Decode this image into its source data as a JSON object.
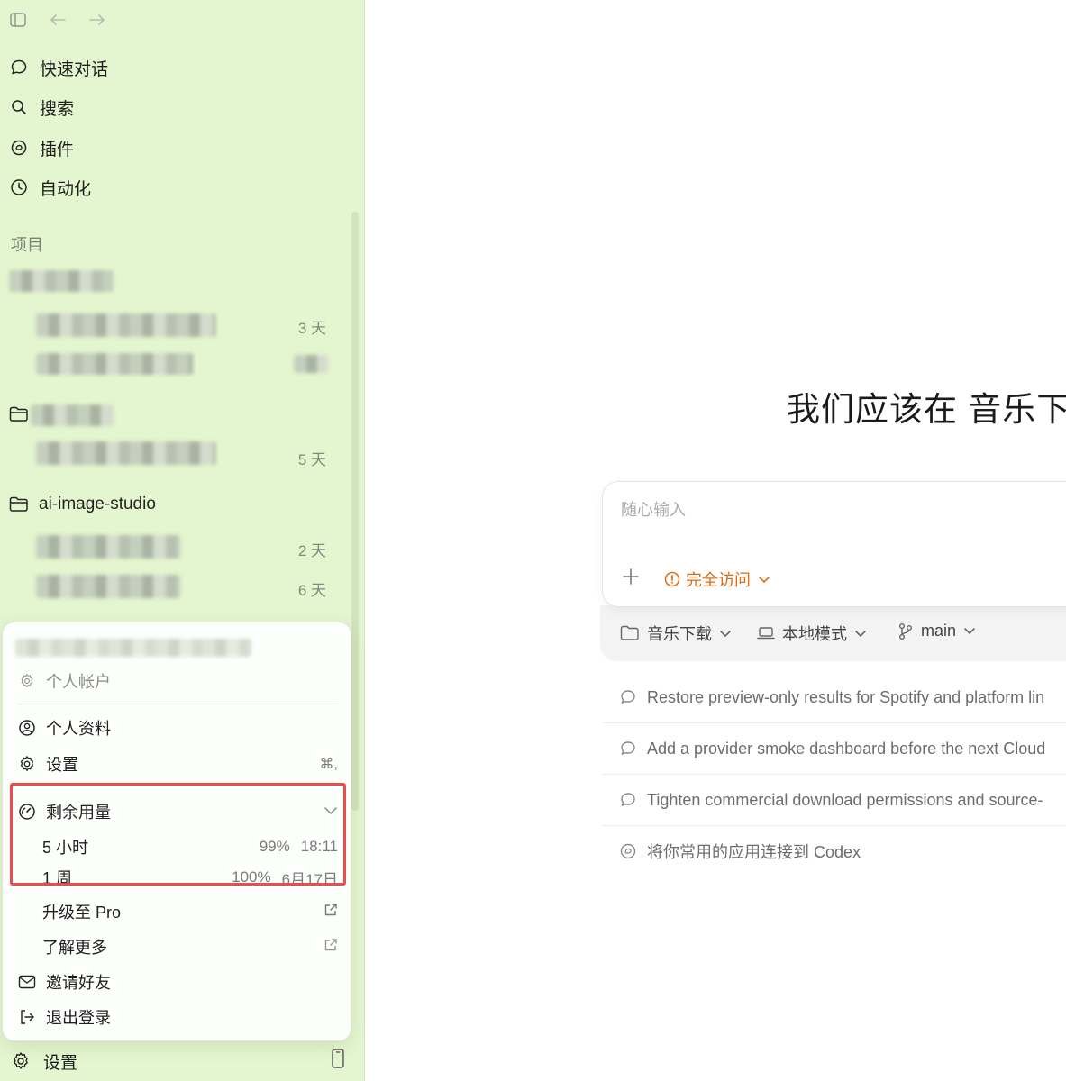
{
  "nav": {
    "quick_chat": "快速对话",
    "search": "搜索",
    "plugins": "插件",
    "automation": "自动化"
  },
  "projects": {
    "section_label": "项目",
    "threads_time": [
      "3 天",
      "5 天",
      "2 天",
      "6 天"
    ],
    "named_project": "ai-image-studio"
  },
  "menu": {
    "account_label": "个人帐户",
    "profile": "个人资料",
    "settings": "设置",
    "settings_shortcut": "⌘,",
    "usage_title": "剩余用量",
    "usage": [
      {
        "period": "5 小时",
        "percent": "99%",
        "reset": "18:11"
      },
      {
        "period": "1 周",
        "percent": "100%",
        "reset": "6月17日"
      }
    ],
    "upgrade": "升级至 Pro",
    "learn_more": "了解更多",
    "invite": "邀请好友",
    "logout": "退出登录"
  },
  "footer": {
    "settings": "设置"
  },
  "main": {
    "headline": "我们应该在 音乐下",
    "composer_placeholder": "随心输入",
    "access_label": "完全访问",
    "folder_label": "音乐下载",
    "mode_label": "本地模式",
    "branch_label": "main",
    "suggestions": [
      "Restore preview-only results for Spotify and platform lin",
      "Add a provider smoke dashboard before the next Cloud",
      "Tighten commercial download permissions and source-",
      "将你常用的应用连接到 Codex"
    ]
  },
  "colors": {
    "sidebar_bg": "#e4f6cf",
    "highlight_border": "#ea4d4d",
    "access_orange": "#de6c14"
  }
}
